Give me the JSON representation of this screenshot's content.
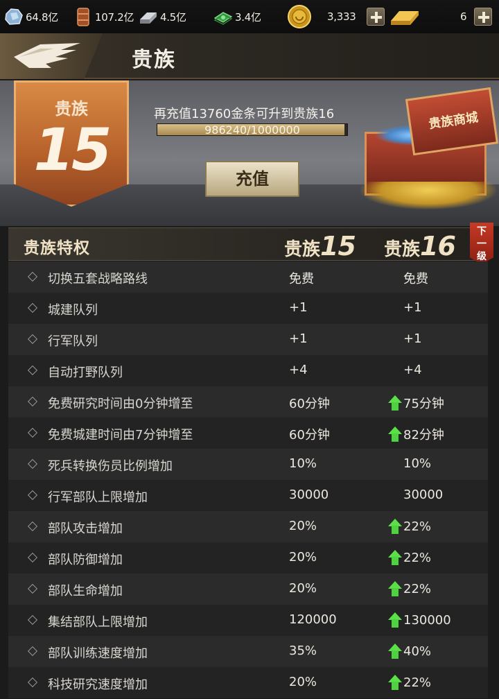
{
  "resources": [
    {
      "icon": "diamond-ore-icon",
      "value": "64.8亿"
    },
    {
      "icon": "oil-barrel-icon",
      "value": "107.2亿"
    },
    {
      "icon": "steel-ingot-icon",
      "value": "4.5亿"
    },
    {
      "icon": "cash-stack-icon",
      "value": "3.4亿"
    }
  ],
  "currency": {
    "gold_coin": {
      "icon": "gold-coin-icon",
      "value": "3,333"
    },
    "gold_bar": {
      "icon": "gold-bar-icon",
      "value": "6"
    }
  },
  "header": {
    "title": "贵族"
  },
  "banner": {
    "badge_label": "贵族",
    "badge_level": "15",
    "recharge_tip": "再充值13760金条可升到贵族16",
    "progress_text": "986240/1000000",
    "progress_fraction": 0.98624,
    "recharge_button": "充值",
    "shop_label": "贵族商城"
  },
  "table": {
    "title": "贵族特权",
    "current_prefix": "贵族",
    "current_level": "15",
    "next_prefix": "贵族",
    "next_level": "16",
    "next_tag": "下一级",
    "rows": [
      {
        "name": "切换五套战略路线",
        "current": "免费",
        "next": "免费",
        "up": false
      },
      {
        "name": "城建队列",
        "current": "+1",
        "next": "+1",
        "up": false
      },
      {
        "name": "行军队列",
        "current": "+1",
        "next": "+1",
        "up": false
      },
      {
        "name": "自动打野队列",
        "current": "+4",
        "next": "+4",
        "up": false
      },
      {
        "name": "免费研究时间由0分钟增至",
        "current": "60分钟",
        "next": "75分钟",
        "up": true
      },
      {
        "name": "免费城建时间由7分钟增至",
        "current": "60分钟",
        "next": "82分钟",
        "up": true
      },
      {
        "name": "死兵转换伤员比例增加",
        "current": "10%",
        "next": "10%",
        "up": false
      },
      {
        "name": "行军部队上限增加",
        "current": "30000",
        "next": "30000",
        "up": false
      },
      {
        "name": "部队攻击增加",
        "current": "20%",
        "next": "22%",
        "up": true
      },
      {
        "name": "部队防御增加",
        "current": "20%",
        "next": "22%",
        "up": true
      },
      {
        "name": "部队生命增加",
        "current": "20%",
        "next": "22%",
        "up": true
      },
      {
        "name": "集结部队上限增加",
        "current": "120000",
        "next": "130000",
        "up": true
      },
      {
        "name": "部队训练速度增加",
        "current": "35%",
        "next": "40%",
        "up": true
      },
      {
        "name": "科技研究速度增加",
        "current": "20%",
        "next": "22%",
        "up": true
      }
    ]
  }
}
